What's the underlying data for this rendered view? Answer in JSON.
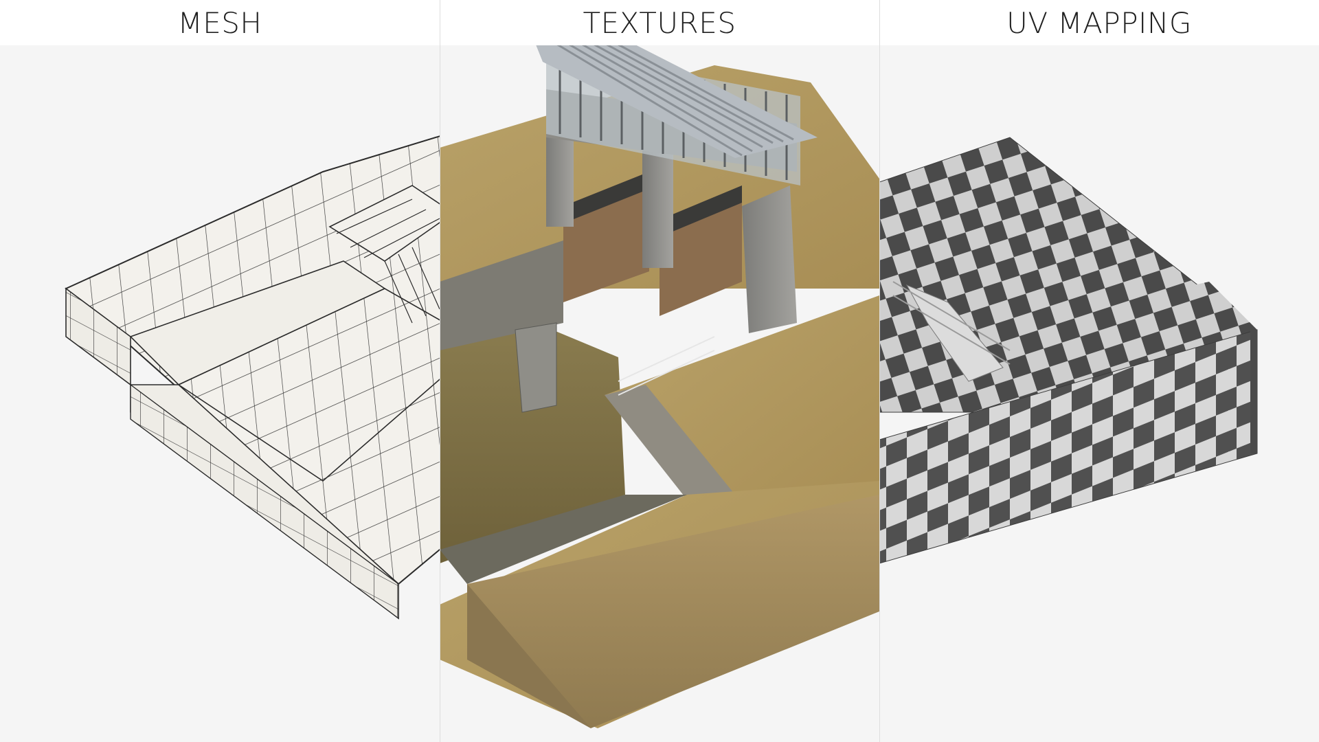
{
  "panels": [
    {
      "title": "MESH",
      "mode": "wireframe"
    },
    {
      "title": "TEXTURES",
      "mode": "textured"
    },
    {
      "title": "UV MAPPING",
      "mode": "checker"
    }
  ],
  "colors": {
    "background": "#f5f5f5",
    "header": "#ffffff",
    "mesh_fill": "#f3f1ec",
    "mesh_line": "#2b2b2b",
    "grass": "#b59a5c",
    "soil": "#a98f5f",
    "water": "#7d6f44",
    "concrete": "#8e8e8c",
    "checker_dark": "#4a4a4a",
    "checker_light": "#cfcfcf"
  }
}
